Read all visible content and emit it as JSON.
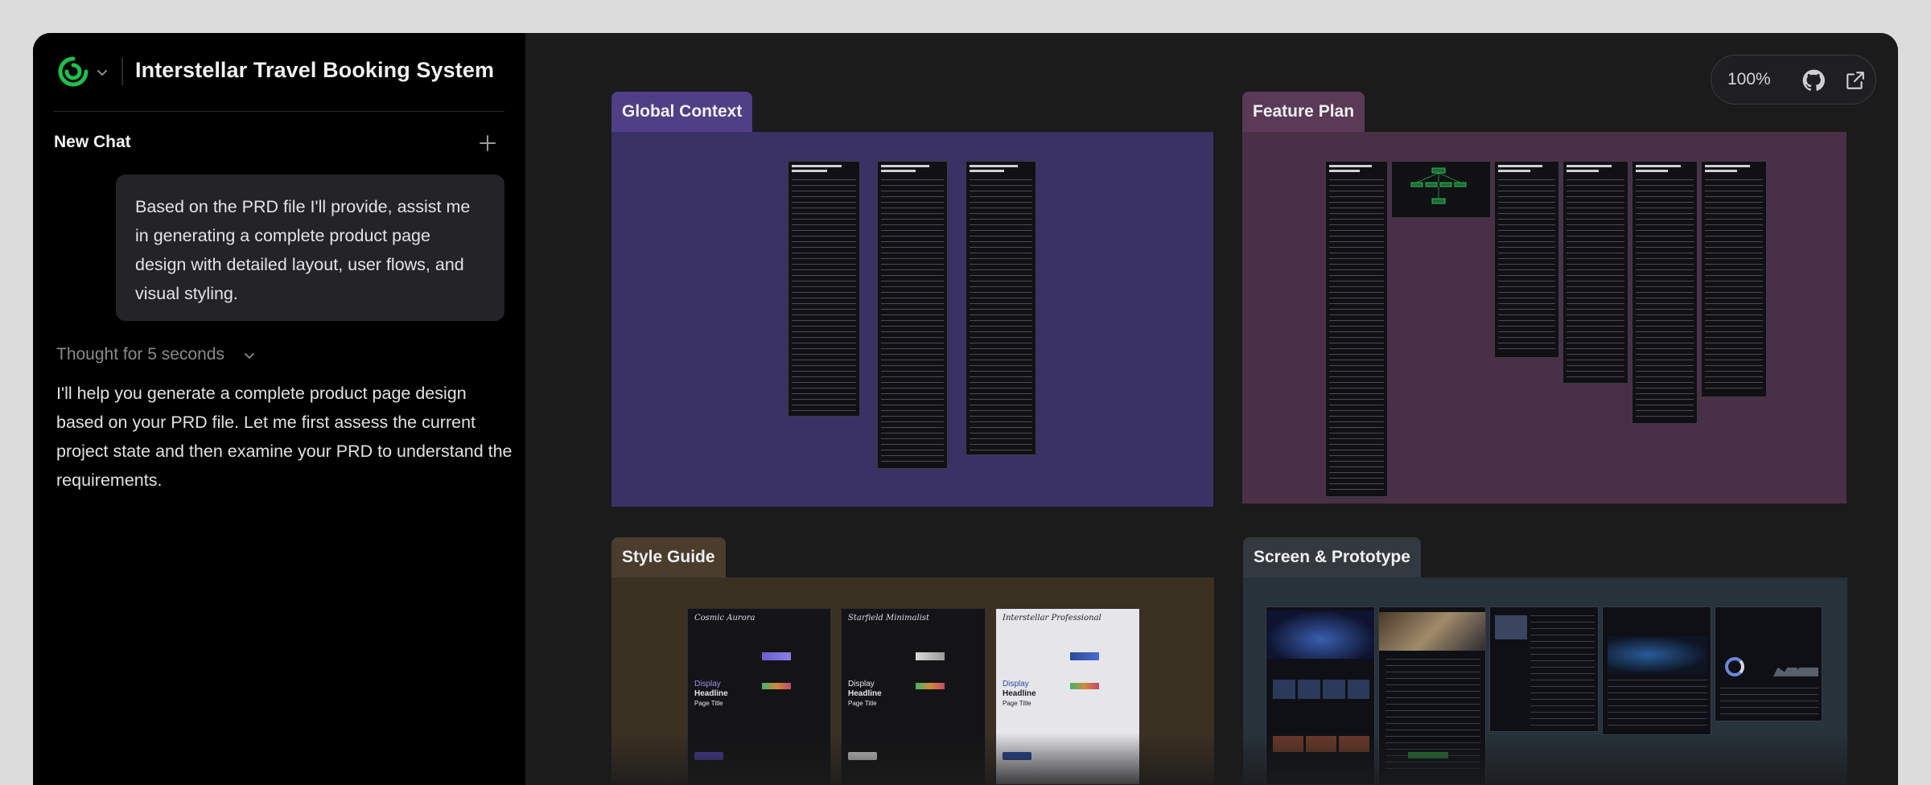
{
  "app": {
    "title": "Interstellar Travel Booking System",
    "brand_color": "#1fbf4d"
  },
  "sidebar": {
    "new_chat_label": "New Chat",
    "user_message": "Based on the PRD file I'll provide, assist me in generating a complete product page design with detailed layout, user flows, and visual styling.",
    "thought_label": "Thought for 5 seconds",
    "assistant_message": "I'll help you generate a complete product page design based on your PRD file. Let me first assess the current project state and then examine your PRD to understand the requirements."
  },
  "canvas": {
    "zoom": "100%",
    "frames": [
      {
        "label": "Global Context",
        "label_color": "#4e3f86",
        "body_color": "#3a3264"
      },
      {
        "label": "Feature Plan",
        "label_color": "#5a3a57",
        "body_color": "#4a3046"
      },
      {
        "label": "Style Guide",
        "label_color": "#4a3d2c",
        "body_color": "#3b3123"
      },
      {
        "label": "Screen & Prototype",
        "label_color": "#33393f",
        "body_color": "#27323a"
      }
    ],
    "style_guides": [
      "Cosmic Aurora",
      "Starfield Minimalist",
      "Interstellar Professional"
    ],
    "style_display_text": [
      "Display",
      "Headline",
      "Page Title"
    ]
  },
  "icons": {
    "logo": "logo-icon",
    "chevron": "chevron-down-icon",
    "plus": "plus-icon",
    "github": "github-icon",
    "external": "external-link-icon"
  }
}
